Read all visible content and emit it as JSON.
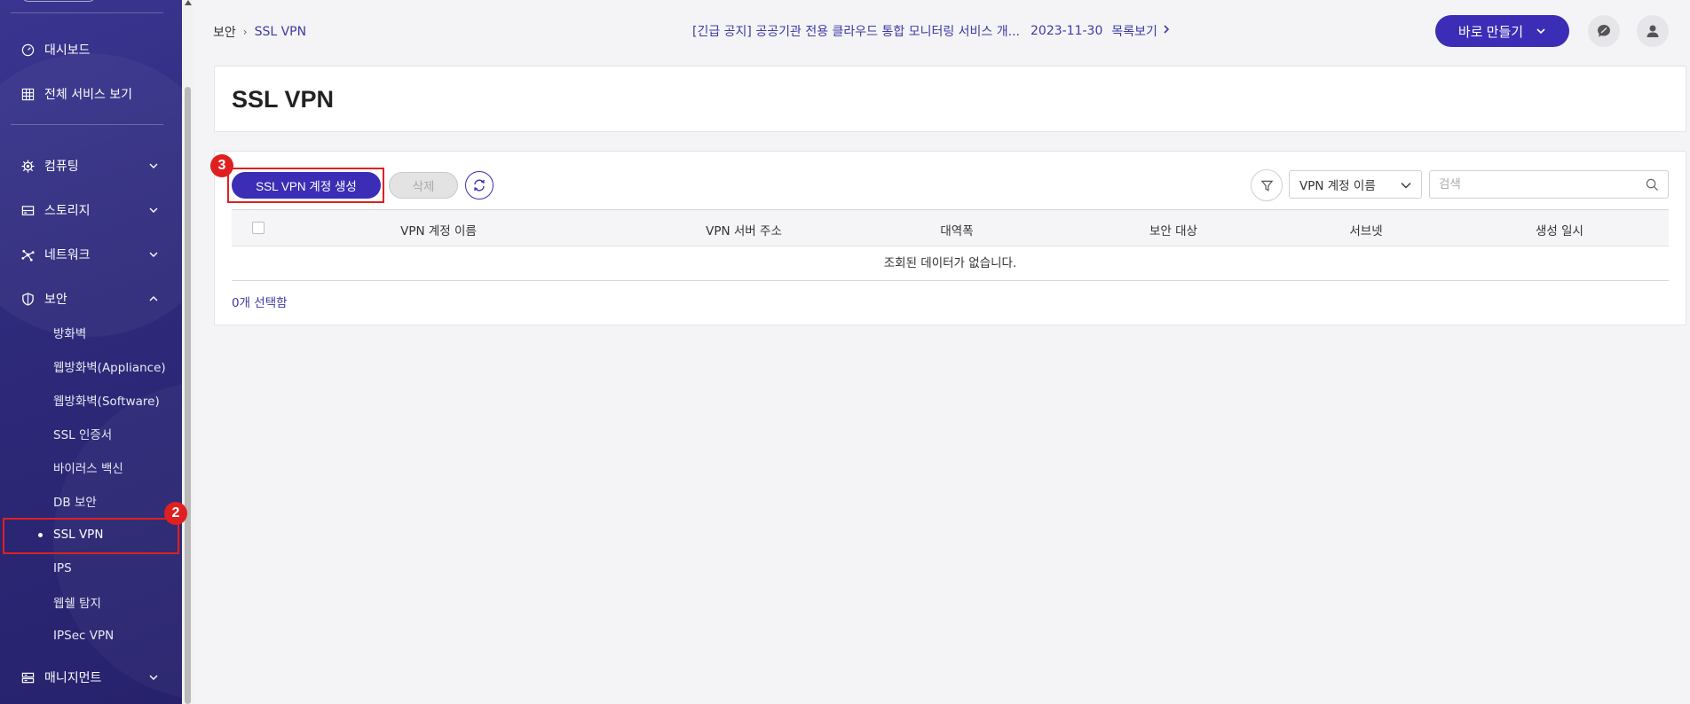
{
  "sidebar": {
    "items": [
      {
        "label": "대시보드",
        "icon": "dashboard-icon"
      },
      {
        "label": "전체 서비스 보기",
        "icon": "grid-icon"
      },
      {
        "label": "컴퓨팅",
        "icon": "cpu-icon"
      },
      {
        "label": "스토리지",
        "icon": "storage-icon"
      },
      {
        "label": "네트워크",
        "icon": "network-icon"
      },
      {
        "label": "보안",
        "icon": "shield-icon"
      },
      {
        "label": "매니지먼트",
        "icon": "management-icon"
      }
    ],
    "security_sub": [
      "방화벽",
      "웹방화벽(Appliance)",
      "웹방화벽(Software)",
      "SSL 인증서",
      "바이러스 백신",
      "DB 보안",
      "SSL VPN",
      "IPS",
      "웹쉘 탐지",
      "IPSec VPN"
    ],
    "active_sub": "SSL VPN"
  },
  "header": {
    "breadcrumb": [
      "보안",
      "SSL VPN"
    ],
    "notice_text": "[긴급 공지] 공공기관 전용 클라우드 통합 모니터링 서비스 개...",
    "notice_date": "2023-11-30",
    "notice_link": "목록보기",
    "quick_create_label": "바로 만들기"
  },
  "page": {
    "title": "SSL VPN"
  },
  "toolbar": {
    "create_label": "SSL VPN 계정 생성",
    "delete_label": "삭제",
    "filter_select_value": "VPN 계정 이름",
    "search_placeholder": "검색"
  },
  "table": {
    "columns": [
      "VPN 계정 이름",
      "VPN 서버 주소",
      "대역폭",
      "보안 대상",
      "서브넷",
      "생성 일시"
    ],
    "empty_message": "조회된 데이터가 없습니다.",
    "selected_count": "0개 선택함"
  },
  "annotations": {
    "step2": "2",
    "step3": "3"
  },
  "colors": {
    "sidebar_bg": "#2e2a7a",
    "primary": "#3b2db5",
    "link": "#3d3aa5",
    "highlight": "#e02020"
  }
}
